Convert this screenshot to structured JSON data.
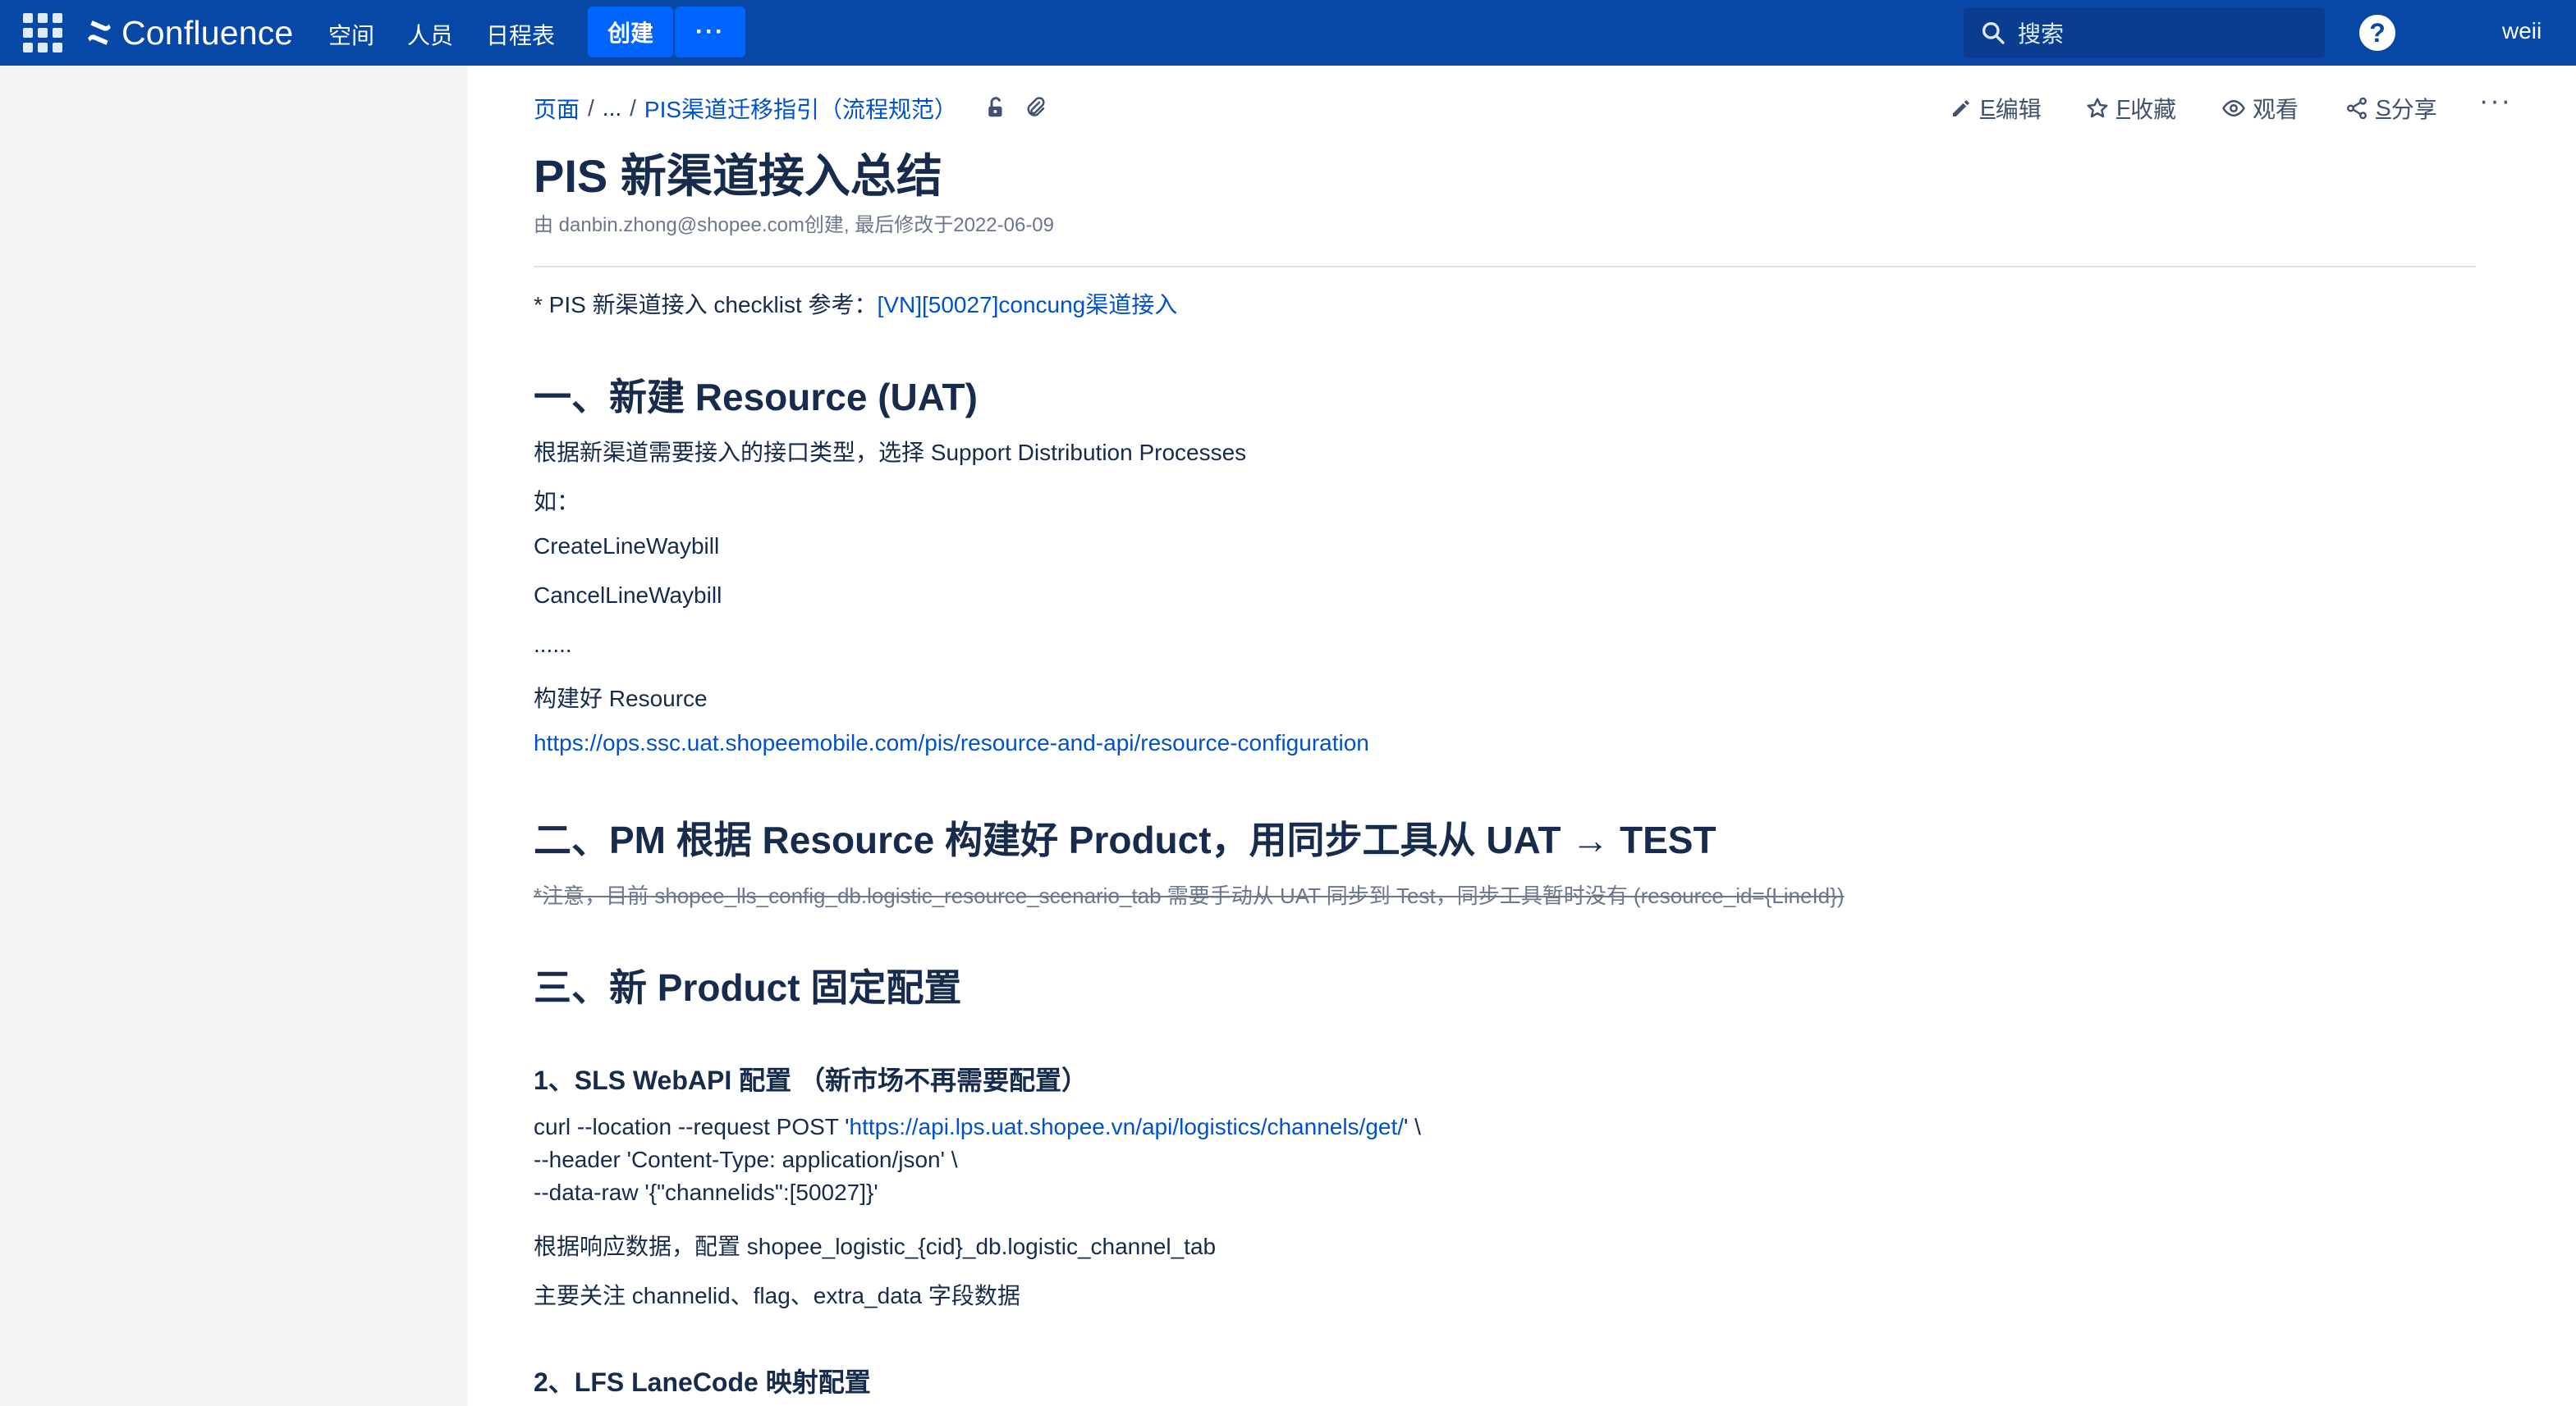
{
  "topbar": {
    "logo_text": "Confluence",
    "nav": [
      "空间",
      "人员",
      "日程表"
    ],
    "create_label": "创建",
    "more_label": "···",
    "search_placeholder": "搜索",
    "help_label": "?",
    "user_name": "weii"
  },
  "toolbar": {
    "breadcrumb": {
      "pages": "页面",
      "sep1": "/",
      "ellipsis": "...",
      "sep2": "/",
      "parent": "PIS渠道迁移指引（流程规范）"
    },
    "edit": {
      "key": "E",
      "label": "编辑"
    },
    "favorite": {
      "key": "F",
      "label": "收藏"
    },
    "watch": {
      "label": "观看"
    },
    "share": {
      "key": "S",
      "label": "分享"
    },
    "more_label": "···"
  },
  "page": {
    "title": "PIS 新渠道接入总结",
    "byline": "由 danbin.zhong@shopee.com创建, 最后修改于2022-06-09",
    "checklist_prefix": "* PIS 新渠道接入 checklist 参考：",
    "checklist_link": "[VN][50027]concung渠道接入",
    "section1": {
      "heading": "一、新建 Resource (UAT)",
      "intro": "根据新渠道需要接入的接口类型，选择 Support Distribution Processes",
      "example_label": "如：",
      "items": [
        "CreateLineWaybill",
        "CancelLineWaybill",
        "......"
      ],
      "build_label": "构建好 Resource",
      "url": "https://ops.ssc.uat.shopeemobile.com/pis/resource-and-api/resource-configuration"
    },
    "section2": {
      "heading": "二、PM 根据 Resource 构建好 Product，用同步工具从 UAT → TEST",
      "note": "*注意，目前 shopee_lls_config_db.logistic_resource_scenario_tab 需要手动从 UAT 同步到 Test，同步工具暂时没有 (resource_id={LineId})"
    },
    "section3": {
      "heading": "三、新 Product 固定配置",
      "sub1": {
        "heading": "1、SLS WebAPI 配置 （新市场不再需要配置）",
        "code_line1_prefix": "curl --location --request POST '",
        "code_line1_link": "https://api.lps.uat.shopee.vn/api/logistics/channels/get/",
        "code_line1_suffix": "' \\",
        "code_line2": "--header 'Content-Type: application/json' \\",
        "code_line3": "--data-raw '{\"channelids\":[50027]}'",
        "para1": "根据响应数据，配置 shopee_logistic_{cid}_db.logistic_channel_tab",
        "para2": "主要关注 channelid、flag、extra_data 字段数据"
      },
      "sub2": {
        "heading": "2、LFS LaneCode 映射配置"
      }
    }
  },
  "colors": {
    "topbar": "#0747a6",
    "create_button": "#0065ff",
    "link": "#0052cc",
    "text": "#172b4d",
    "muted": "#6b778c",
    "sidebar": "#f4f5f7"
  }
}
